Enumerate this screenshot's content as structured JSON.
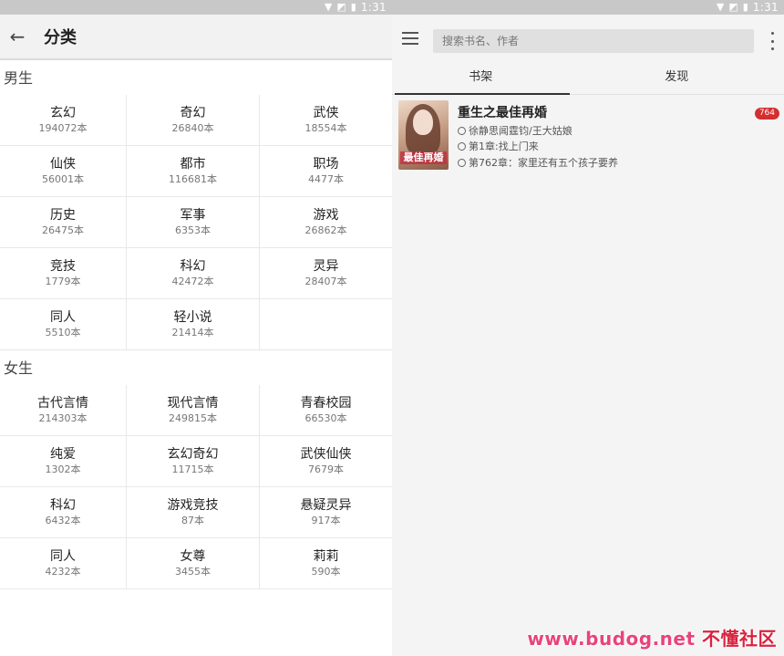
{
  "status": {
    "time": "1:31"
  },
  "left": {
    "title": "分类",
    "sections": [
      {
        "title": "男生",
        "items": [
          {
            "name": "玄幻",
            "count": "194072本"
          },
          {
            "name": "奇幻",
            "count": "26840本"
          },
          {
            "name": "武侠",
            "count": "18554本"
          },
          {
            "name": "仙侠",
            "count": "56001本"
          },
          {
            "name": "都市",
            "count": "116681本"
          },
          {
            "name": "职场",
            "count": "4477本"
          },
          {
            "name": "历史",
            "count": "26475本"
          },
          {
            "name": "军事",
            "count": "6353本"
          },
          {
            "name": "游戏",
            "count": "26862本"
          },
          {
            "name": "竞技",
            "count": "1779本"
          },
          {
            "name": "科幻",
            "count": "42472本"
          },
          {
            "name": "灵异",
            "count": "28407本"
          },
          {
            "name": "同人",
            "count": "5510本"
          },
          {
            "name": "轻小说",
            "count": "21414本"
          }
        ]
      },
      {
        "title": "女生",
        "items": [
          {
            "name": "古代言情",
            "count": "214303本"
          },
          {
            "name": "现代言情",
            "count": "249815本"
          },
          {
            "name": "青春校园",
            "count": "66530本"
          },
          {
            "name": "纯爱",
            "count": "1302本"
          },
          {
            "name": "玄幻奇幻",
            "count": "11715本"
          },
          {
            "name": "武侠仙侠",
            "count": "7679本"
          },
          {
            "name": "科幻",
            "count": "6432本"
          },
          {
            "name": "游戏竞技",
            "count": "87本"
          },
          {
            "name": "悬疑灵异",
            "count": "917本"
          },
          {
            "name": "同人",
            "count": "4232本"
          },
          {
            "name": "女尊",
            "count": "3455本"
          },
          {
            "name": "莉莉",
            "count": "590本"
          }
        ]
      }
    ]
  },
  "right": {
    "search_placeholder": "搜索书名、作者",
    "tabs": [
      {
        "label": "书架",
        "active": true
      },
      {
        "label": "发现",
        "active": false
      }
    ],
    "books": [
      {
        "title": "重生之最佳再婚",
        "author": "徐静思闻霆钧/王大姑娘",
        "read_chapter": "第1章:找上门来",
        "latest_chapter": "第762章：家里还有五个孩子要养",
        "unread_badge": "764",
        "cover_text": "最佳再婚"
      }
    ]
  },
  "watermark": {
    "url": "www.budog.net",
    "name": "不懂社区"
  },
  "colors": {
    "badge": "#d32f2f",
    "watermark": "#e8447a"
  }
}
